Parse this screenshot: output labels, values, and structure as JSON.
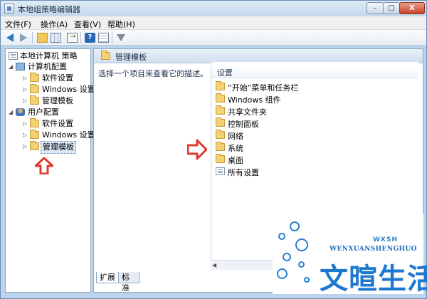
{
  "window": {
    "title": "本地组策略编辑器",
    "controls": {
      "minimize": "–",
      "maximize": "□",
      "close": "X"
    }
  },
  "menu": [
    "文件(F)",
    "操作(A)",
    "查看(V)",
    "帮助(H)"
  ],
  "toolbar": {
    "icons": [
      "back-arrow-icon",
      "forward-arrow-icon",
      "up-folder-icon",
      "show-hide-tree-icon",
      "export-list-icon",
      "help-icon",
      "properties-icon",
      "filter-icon"
    ]
  },
  "tree": {
    "root": "本地计算机 策略",
    "computer_config": {
      "label": "计算机配置",
      "children": [
        "软件设置",
        "Windows 设置",
        "管理模板"
      ]
    },
    "user_config": {
      "label": "用户配置",
      "children": [
        "软件设置",
        "Windows 设置",
        "管理模板"
      ]
    },
    "selected": "管理模板"
  },
  "right_pane": {
    "header": "管理模板",
    "description": "选择一个项目来查看它的描述。",
    "list_header": "设置",
    "items": [
      "“开始”菜单和任务栏",
      "Windows 组件",
      "共享文件夹",
      "控制面板",
      "网络",
      "系统",
      "桌面",
      "所有设置"
    ]
  },
  "tabs": [
    "扩展",
    "标准"
  ],
  "watermark": {
    "title": "文暄生活",
    "subtitle": "WENXUANSHENGHUO",
    "tag": "WXSH"
  },
  "colors": {
    "arrow_red": "#e23a2e",
    "watermark_blue": "#1f78d0",
    "folder_yellow": "#f3d273"
  }
}
